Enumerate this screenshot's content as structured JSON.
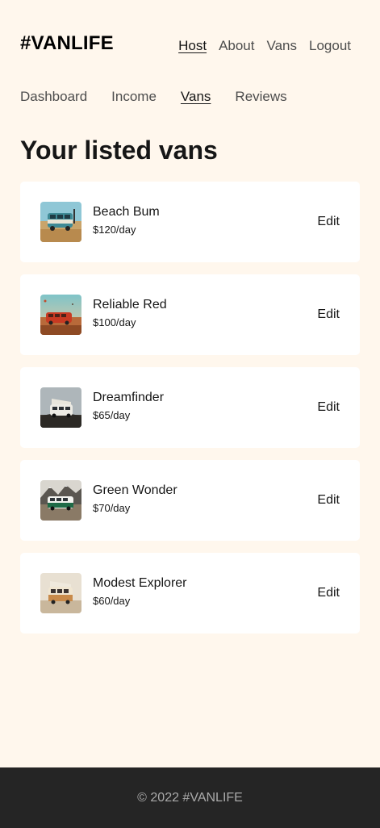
{
  "header": {
    "logo": "#VANLIFE",
    "nav": [
      {
        "label": "Host",
        "active": true
      },
      {
        "label": "About",
        "active": false
      },
      {
        "label": "Vans",
        "active": false
      },
      {
        "label": "Logout",
        "active": false
      }
    ]
  },
  "host_nav": [
    {
      "label": "Dashboard",
      "active": false
    },
    {
      "label": "Income",
      "active": false
    },
    {
      "label": "Vans",
      "active": true
    },
    {
      "label": "Reviews",
      "active": false
    }
  ],
  "main": {
    "title": "Your listed vans",
    "vans": [
      {
        "name": "Beach Bum",
        "price": "$120/day",
        "edit_label": "Edit",
        "thumb": "teal-van-beach"
      },
      {
        "name": "Reliable Red",
        "price": "$100/day",
        "edit_label": "Edit",
        "thumb": "red-van-field"
      },
      {
        "name": "Dreamfinder",
        "price": "$65/day",
        "edit_label": "Edit",
        "thumb": "white-van-hill"
      },
      {
        "name": "Green Wonder",
        "price": "$70/day",
        "edit_label": "Edit",
        "thumb": "green-van-mountains"
      },
      {
        "name": "Modest Explorer",
        "price": "$60/day",
        "edit_label": "Edit",
        "thumb": "cream-van-desert"
      }
    ]
  },
  "footer": {
    "text": "© 2022 #VANLIFE"
  },
  "colors": {
    "background": "#FFF7ED",
    "card": "#FFFFFF",
    "text": "#161616",
    "muted": "#4D4D4D",
    "footer_bg": "#252525",
    "footer_text": "#AAAAAA"
  }
}
